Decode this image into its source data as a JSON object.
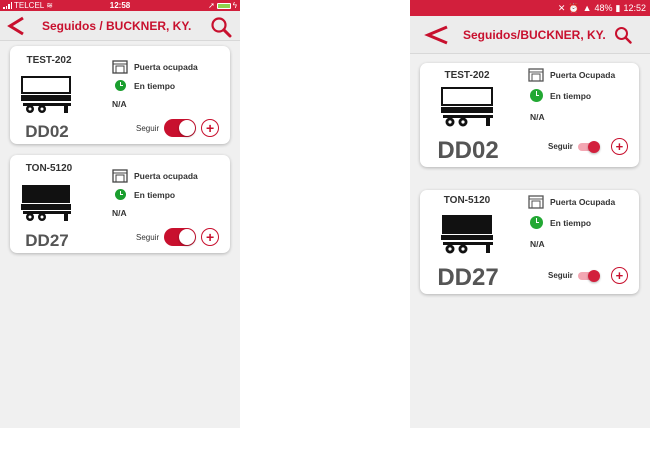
{
  "ios": {
    "status": {
      "carrier": "TELCEL",
      "time": "12:58"
    },
    "header": {
      "title": "Seguidos / BUCKNER, KY."
    },
    "cards": [
      {
        "trailer": "TEST-202",
        "door_status": "Puerta ocupada",
        "time_status": "En tiempo",
        "extra": "N/A",
        "dock": "DD02",
        "follow_label": "Seguir",
        "follow_on": true,
        "trailer_style": "outline"
      },
      {
        "trailer": "TON-5120",
        "door_status": "Puerta ocupada",
        "time_status": "En tiempo",
        "extra": "N/A",
        "dock": "DD27",
        "follow_label": "Seguir",
        "follow_on": true,
        "trailer_style": "filled"
      }
    ]
  },
  "android": {
    "status": {
      "battery": "48%",
      "time": "12:52"
    },
    "header": {
      "title": "Seguidos/BUCKNER, KY."
    },
    "cards": [
      {
        "trailer": "TEST-202",
        "door_status": "Puerta Ocupada",
        "time_status": "En tiempo",
        "extra": "N/A",
        "dock": "DD02",
        "follow_label": "Seguir",
        "follow_on": true,
        "trailer_style": "outline"
      },
      {
        "trailer": "TON-5120",
        "door_status": "Puerta Ocupada",
        "time_status": "En tiempo",
        "extra": "N/A",
        "dock": "DD27",
        "follow_label": "Seguir",
        "follow_on": true,
        "trailer_style": "filled"
      }
    ]
  },
  "icons": {
    "back": "chevron-left-icon",
    "search": "search-icon",
    "door": "garage-door-icon",
    "clock": "clock-icon",
    "add": "plus-circle-icon"
  },
  "colors": {
    "brand": "#c8102e",
    "status_bar": "#d21f3c",
    "on_time": "#1a9e2e"
  }
}
